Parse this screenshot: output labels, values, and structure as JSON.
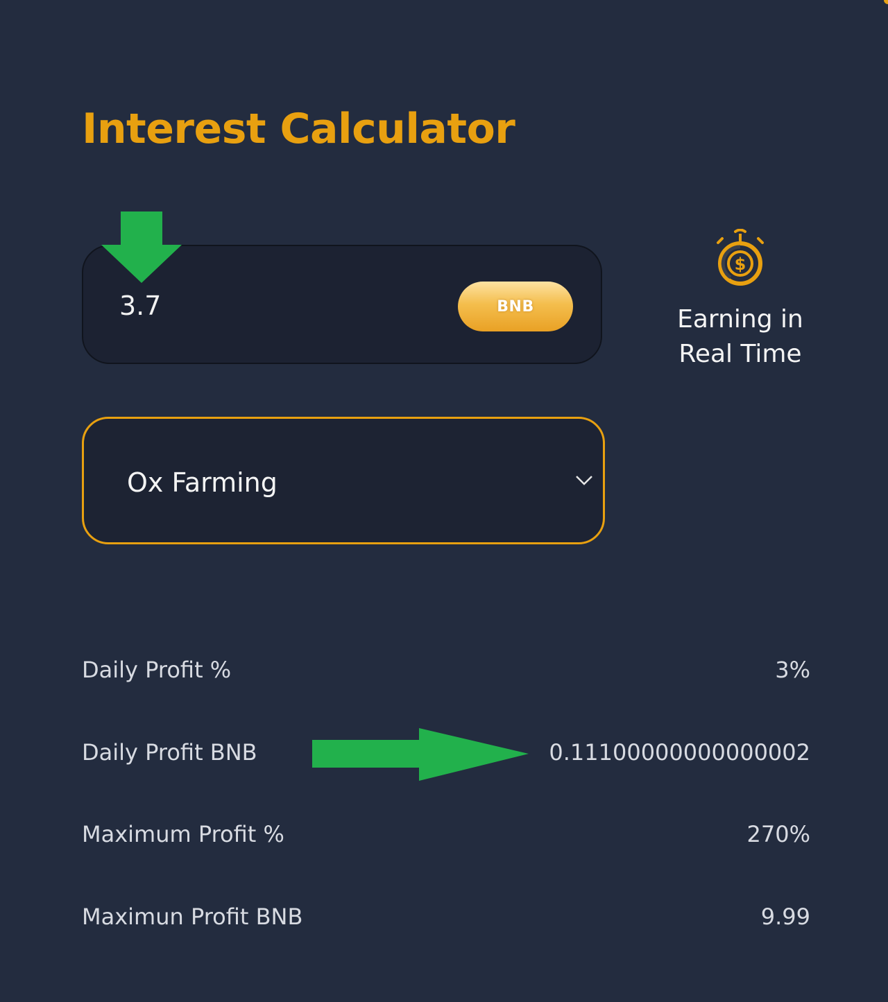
{
  "title": "Interest Calculator",
  "colors": {
    "background": "#232c3f",
    "accent": "#e8a010",
    "arrow_green": "#22b14c",
    "input_bg": "#1c2232",
    "text": "#f4f4f4"
  },
  "amount_input": {
    "value": "3.7",
    "currency_button": "BNB"
  },
  "earning_badge": {
    "icon": "stopwatch-dollar-icon",
    "text": "Earning in\nReal Time"
  },
  "plan_select": {
    "selected": "Ox Farming",
    "icon": "chevron-down-icon"
  },
  "annotations": {
    "arrow_down_icon": "green-arrow-down-icon",
    "arrow_right_icon": "green-arrow-right-icon"
  },
  "stats": [
    {
      "label": "Daily Profit %",
      "value": "3%"
    },
    {
      "label": "Daily Profit BNB",
      "value": "0.11100000000000002"
    },
    {
      "label": "Maximum Profit %",
      "value": "270%"
    },
    {
      "label": "Maximun Profit BNB",
      "value": "9.99"
    }
  ]
}
